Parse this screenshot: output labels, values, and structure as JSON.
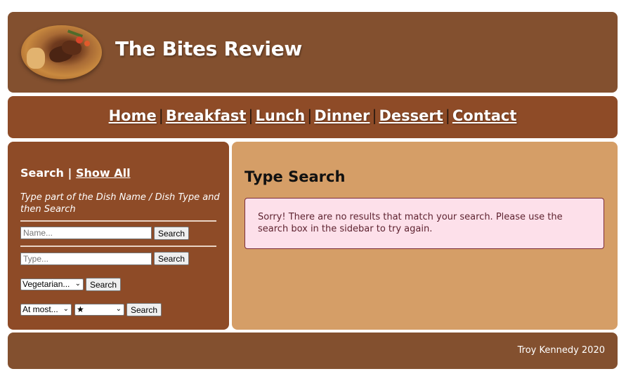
{
  "header": {
    "logo_alt": "steak dish logo",
    "site_title": "The Bites Review"
  },
  "nav": {
    "items": [
      "Home",
      "Breakfast",
      "Lunch",
      "Dinner",
      "Dessert",
      "Contact"
    ],
    "separator": "|"
  },
  "sidebar": {
    "search_label": "Search",
    "separator": "|",
    "show_all_label": "Show All",
    "hint": "Type part of the Dish Name / Dish Type and then Search",
    "name_input": {
      "placeholder": "Name...",
      "value": ""
    },
    "name_button": "Search",
    "type_input": {
      "placeholder": "Type...",
      "value": ""
    },
    "type_button": "Search",
    "veg_select": {
      "selected": "Vegetarian..."
    },
    "veg_button": "Search",
    "atmost_select": {
      "selected": "At most..."
    },
    "rating_select": {
      "selected": "★"
    },
    "rating_button": "Search"
  },
  "main": {
    "title": "Type Search",
    "alert": "Sorry! There are no results that match your search. Please use the search box in the sidebar to try again."
  },
  "footer": {
    "text": "Troy Kennedy 2020"
  },
  "colors": {
    "header_bg": "#83502f",
    "nav_bg": "#8e4b27",
    "main_bg": "#d59e67",
    "alert_bg": "#fde0ea"
  }
}
